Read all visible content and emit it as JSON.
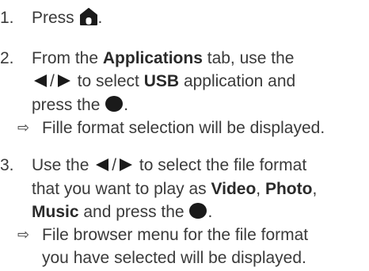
{
  "steps": [
    {
      "number": "1.",
      "before_icon": "Press",
      "icon": "home-icon",
      "after_icon": "."
    },
    {
      "number": "2.",
      "line1_a": "From the",
      "line1_b": "Applications",
      "line1_c": "tab, use the",
      "line2_slash": "/",
      "line2_a": "to select",
      "line2_b": "USB",
      "line2_c": "application and",
      "line3_a": "press the",
      "line3_end": ".",
      "result_arrow": "⇨",
      "result": "Fille format selection will be displayed."
    },
    {
      "number": "3.",
      "line1_a": "Use the",
      "line1_slash": "/",
      "line1_b": "to select the file format",
      "line2_a": "that you want to play as",
      "line2_b": "Video",
      "line2_c": ",",
      "line2_d": "Photo",
      "line2_e": ",",
      "line3_a": "Music",
      "line3_b": "and press the",
      "line3_end": ".",
      "result_arrow": "⇨",
      "result_line1": "File browser menu for the file format",
      "result_line2": "you have selected will be displayed."
    }
  ],
  "icons": {
    "home": "home-icon",
    "left_right": "left-right-arrows-icon",
    "ok": "ok-button-icon"
  },
  "colors": {
    "text": "#3a3a3a",
    "icon": "#1a1a1a"
  }
}
